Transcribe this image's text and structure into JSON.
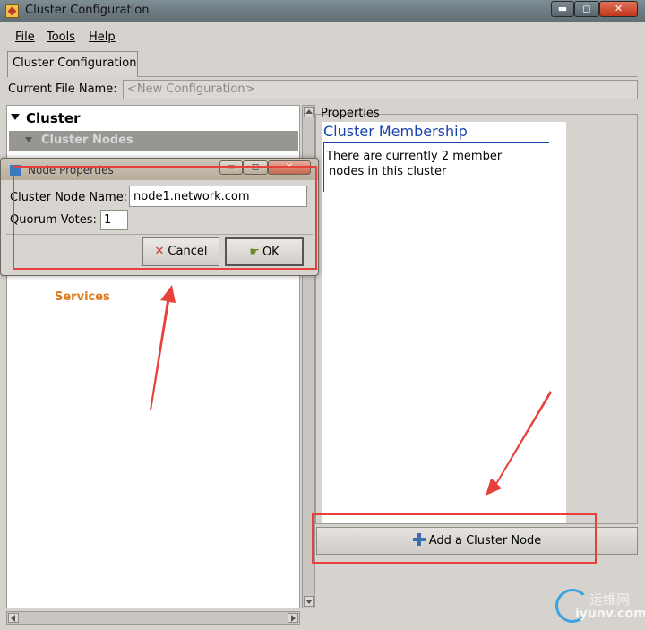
{
  "window": {
    "title": "Cluster Configuration",
    "controls": {
      "minimize": "▬",
      "maximize": "◻",
      "close": "✕"
    }
  },
  "menu": {
    "file": "File",
    "tools": "Tools",
    "help": "Help"
  },
  "tabs": [
    {
      "label": "Cluster Configuration"
    }
  ],
  "file_name": {
    "label": "Current File Name:",
    "value": "<New Configuration>"
  },
  "tree": {
    "root": "Cluster",
    "items": [
      {
        "label": "Cluster Nodes",
        "selected": true
      },
      {
        "label": "Services"
      }
    ]
  },
  "properties": {
    "section_label": "Properties",
    "heading": "Cluster Membership",
    "body_line1": "There are currently 2 member",
    "body_line2": "nodes in this cluster",
    "add_button": "Add a Cluster Node"
  },
  "dialog": {
    "title": "Node Properties",
    "node_name_label": "Cluster Node Name:",
    "node_name_value": "node1.network.com",
    "quorum_label": "Quorum Votes:",
    "quorum_value": "1",
    "cancel_label": "Cancel",
    "ok_label": "OK"
  },
  "watermark": {
    "cn": "运维网",
    "en": "iyunv.com"
  },
  "colors": {
    "annotation": "#e8403a",
    "heading": "#1a43b0",
    "services": "#e07a1a"
  }
}
